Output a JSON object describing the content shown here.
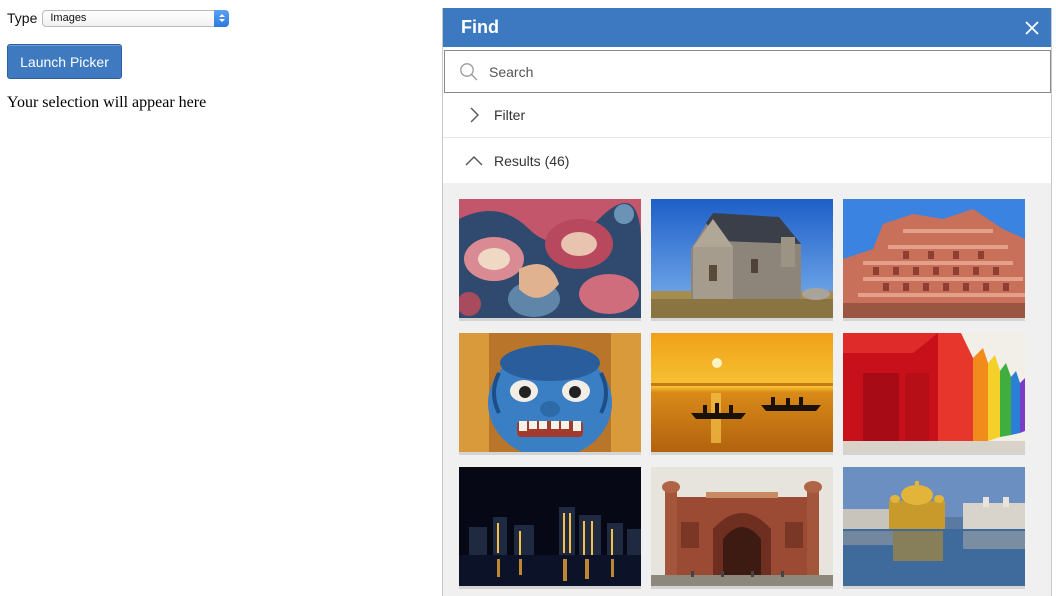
{
  "host": {
    "type_label": "Type",
    "type_select_value": "Images",
    "launch_button_label": "Launch Picker",
    "selection_text": "Your selection will appear here"
  },
  "find_panel": {
    "title": "Find",
    "search_placeholder": "Search",
    "filter_label": "Filter",
    "results_label": "Results (46)",
    "header_color": "#3d79c1"
  },
  "thumbnails": [
    {
      "subject": "paisley-textile"
    },
    {
      "subject": "stone-church"
    },
    {
      "subject": "hawa-mahal-palace"
    },
    {
      "subject": "blue-demon-mask"
    },
    {
      "subject": "sunset-boats-river"
    },
    {
      "subject": "colorful-beach-huts"
    },
    {
      "subject": "city-skyline-night"
    },
    {
      "subject": "red-sandstone-gateway"
    },
    {
      "subject": "golden-temple"
    }
  ]
}
